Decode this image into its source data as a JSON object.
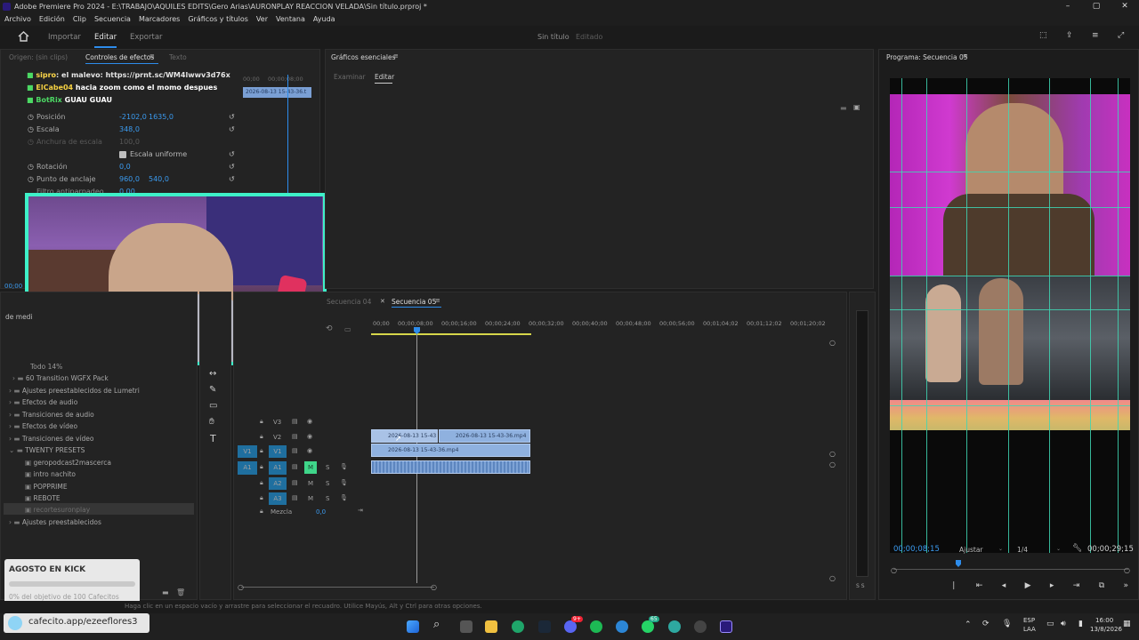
{
  "window": {
    "title": "Adobe Premiere Pro 2024 - E:\\TRABAJO\\AQUILES EDITS\\Gero Arias\\AURONPLAY REACCION VELADA\\Sin título.prproj *",
    "minimize": "–",
    "maximize": "▢",
    "close": "✕"
  },
  "menu": [
    "Archivo",
    "Edición",
    "Clip",
    "Secuencia",
    "Marcadores",
    "Gráficos y títulos",
    "Ver",
    "Ventana",
    "Ayuda"
  ],
  "workspace": {
    "tabs": [
      "Importar",
      "Editar",
      "Exportar"
    ],
    "project_title": "Sin título",
    "project_status": "Editado"
  },
  "effect_controls": {
    "tab_source": "Origen: (sin clips)",
    "tab_effects": "Controles de efectos",
    "tab_text": "Texto",
    "clip_label": "2026-08-13 15-43-36.t",
    "ruler_start": "00;00",
    "ruler_mid": "00;00;08;00",
    "rows": [
      {
        "name": "Posición",
        "v1": "-2102,0",
        "v2": "1635,0"
      },
      {
        "name": "Escala",
        "v1": "348,0",
        "v2": ""
      },
      {
        "name": "Anchura de escala",
        "v1": "100,0",
        "v2": ""
      },
      {
        "name": "Escala uniforme",
        "v1": "",
        "v2": ""
      },
      {
        "name": "Rotación",
        "v1": "0,0",
        "v2": ""
      },
      {
        "name": "Punto de anclaje",
        "v1": "960,0",
        "v2": "540,0"
      },
      {
        "name": "Filtro antiparpadeo",
        "v1": "0,00",
        "v2": ""
      }
    ],
    "timecode": "00;00"
  },
  "chat": [
    {
      "user": "sipro",
      "msg": "el malevo: https://prnt.sc/WM4lwwv3d76x",
      "color": "#ffd84a"
    },
    {
      "user": "ElCabe04",
      "msg": "hacia zoom como el momo despues",
      "color": "#f5d142"
    },
    {
      "user": "BotRix",
      "msg": "GUAU GUAU",
      "color": "#4cd964"
    }
  ],
  "essential_graphics": {
    "title": "Gráficos esenciales",
    "tab_browse": "Examinar",
    "tab_edit": "Editar"
  },
  "program": {
    "title": "Programa: Secuencia 05",
    "timecode": "00;00;08;15",
    "fit": "Ajustar",
    "ratio": "1/4",
    "duration": "00;00;29;15"
  },
  "project": {
    "header": "de medi",
    "items": [
      {
        "name": "Todo 14%",
        "indent": 1
      },
      {
        "name": "60 Transition WGFX Pack",
        "indent": 1
      },
      {
        "name": "Ajustes preestablecidos de Lumetri",
        "indent": 0
      },
      {
        "name": "Efectos de audio",
        "indent": 0
      },
      {
        "name": "Transiciones de audio",
        "indent": 0
      },
      {
        "name": "Efectos de vídeo",
        "indent": 0
      },
      {
        "name": "Transiciones de vídeo",
        "indent": 0
      },
      {
        "name": "TWENTY PRESETS",
        "indent": 0
      },
      {
        "name": "geropodcast2mascerca",
        "indent": 1
      },
      {
        "name": "intro nachito",
        "indent": 1
      },
      {
        "name": "POPPRIME",
        "indent": 1
      },
      {
        "name": "REBOTE",
        "indent": 1
      },
      {
        "name": "recortesuronplay",
        "indent": 1
      },
      {
        "name": "Ajustes preestablecidos",
        "indent": 0
      }
    ]
  },
  "timeline": {
    "tab_prev": "Secuencia 04",
    "tab_active": "Secuencia 05",
    "ruler": [
      "00;00",
      "00;00;08;00",
      "00;00;16;00",
      "00;00;24;00",
      "00;00;32;00",
      "00;00;40;00",
      "00;00;48;00",
      "00;00;56;00",
      "00;01;04;02",
      "00;01;12;02",
      "00;01;20;02"
    ],
    "tracks": [
      {
        "id": "V3",
        "type": "video"
      },
      {
        "id": "V2",
        "type": "video"
      },
      {
        "id": "V1",
        "type": "video",
        "src": "V1"
      },
      {
        "id": "A1",
        "type": "audio",
        "src": "A1",
        "m": "M",
        "s": "S"
      },
      {
        "id": "A2",
        "type": "audio",
        "m": "M",
        "s": "S"
      },
      {
        "id": "A3",
        "type": "audio",
        "m": "M",
        "s": "S"
      }
    ],
    "mix_label": "Mezcla",
    "mix_value": "0,0",
    "clips": {
      "v2_a": "2026-08-13 15-43",
      "v2_b": "2026-08-13 15-43-36.mp4",
      "v1": "2026-08-13 15-43-36.mp4"
    },
    "meter_label": "S S"
  },
  "status_bar": "Haga clic en un espacio vacío y arrastre para seleccionar el recuadro. Utilice Mayús, Alt y Ctrl para otras opciones.",
  "overlay": {
    "goal_title": "AGOSTO EN KICK",
    "goal_text": "0% del objetivo de 100 Cafecitos",
    "goal_progress": 0.0,
    "donate_link": "cafecito.app/ezeeflores3"
  },
  "taskbar": {
    "lang_top": "ESP",
    "lang_bottom": "LAA",
    "time": "16:00",
    "date": "13/8/2026",
    "badge_discord": "9+",
    "badge_whatsapp": "65"
  },
  "colors": {
    "accent": "#2d8ceb",
    "webcam_border": "#3ef0c8",
    "guide": "#3fd6b4",
    "track_active": "#1f6f9f",
    "clip": "#8fb1df"
  }
}
